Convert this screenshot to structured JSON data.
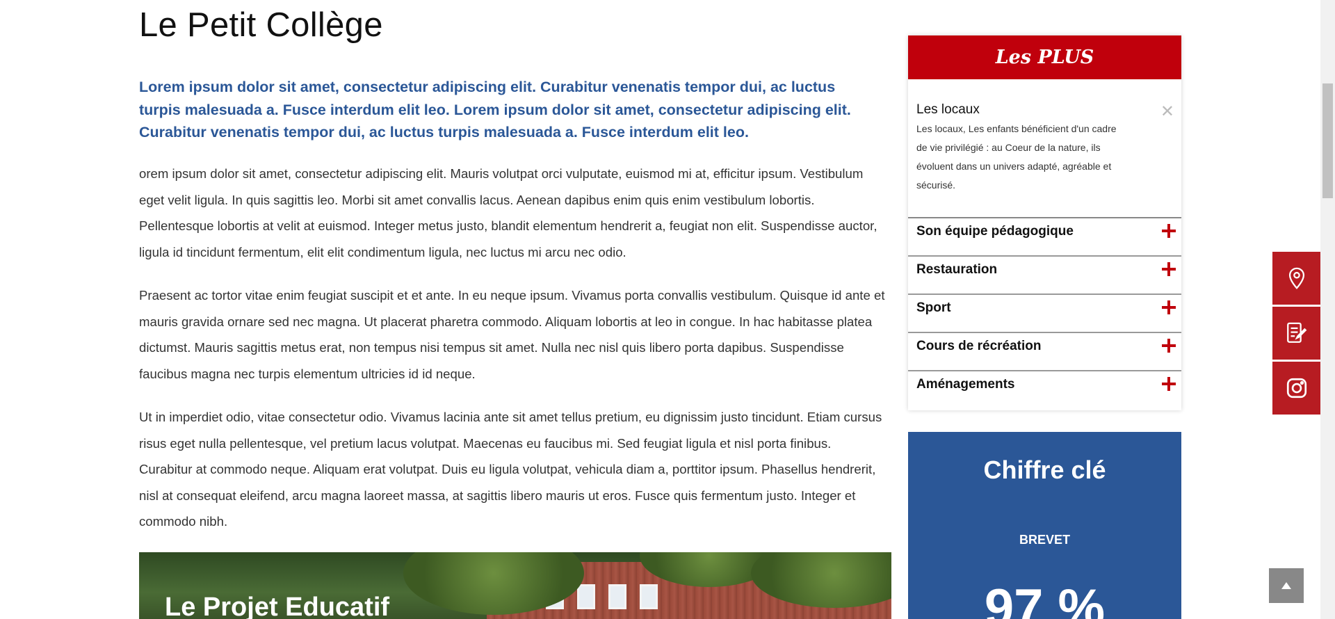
{
  "main": {
    "title": "Le Petit Collège",
    "lead": "Lorem ipsum dolor sit amet, consectetur adipiscing elit. Curabitur venenatis tempor dui, ac luctus turpis malesuada a. Fusce interdum elit leo. Lorem ipsum dolor sit amet, consectetur adipiscing elit. Curabitur venenatis tempor dui, ac luctus turpis malesuada a. Fusce interdum elit leo.",
    "paragraphs": [
      "orem ipsum dolor sit amet, consectetur adipiscing elit. Mauris volutpat orci vulputate, euismod mi at, efficitur ipsum. Vestibulum eget velit ligula. In quis sagittis leo. Morbi sit amet convallis lacus. Aenean dapibus enim quis enim vestibulum lobortis. Pellentesque lobortis at velit at euismod. Integer metus justo, blandit elementum hendrerit a, feugiat non elit. Suspendisse auctor, ligula id tincidunt fermentum, elit elit condimentum ligula, nec luctus mi arcu nec odio.",
      "Praesent ac tortor vitae enim feugiat suscipit et et ante. In eu neque ipsum. Vivamus porta convallis vestibulum. Quisque id ante et mauris gravida ornare sed nec magna. Ut placerat pharetra commodo. Aliquam lobortis at leo in congue. In hac habitasse platea dictumst. Mauris sagittis metus erat, non tempus nisi tempus sit amet. Nulla nec nisl quis libero porta dapibus. Suspendisse faucibus magna nec turpis elementum ultricies id id neque.",
      "Ut in imperdiet odio, vitae consectetur odio. Vivamus lacinia ante sit amet tellus pretium, eu dignissim justo tincidunt. Etiam cursus risus eget nulla pellentesque, vel pretium lacus volutpat. Maecenas eu faucibus mi. Sed feugiat ligula et nisl porta finibus. Curabitur at commodo neque. Aliquam erat volutpat. Duis eu ligula volutpat, vehicula diam a, porttitor ipsum. Phasellus hendrerit, nisl at consequat eleifend, arcu magna laoreet massa, at sagittis libero mauris ut eros. Fusce quis fermentum justo. Integer et commodo nibh."
    ],
    "hero_title": "Le Projet Educatif"
  },
  "sidebar": {
    "plus_title": "Les PLUS",
    "open_item": {
      "title": "Les locaux",
      "close_glyph": "✕",
      "body": "Les locaux, Les enfants bénéficient d'un cadre de vie privilégié : au Coeur de la nature, ils évoluent dans un univers adapté, agréable et sécurisé."
    },
    "items": [
      {
        "label": "Son équipe pédagogique"
      },
      {
        "label": "Restauration"
      },
      {
        "label": "Sport"
      },
      {
        "label": "Cours de récréation"
      },
      {
        "label": "Aménagements"
      }
    ],
    "key_figure": {
      "title": "Chiffre clé",
      "label": "BREVET",
      "value": "97 %"
    }
  },
  "floating_buttons": [
    {
      "icon": "map-pin-icon"
    },
    {
      "icon": "document-edit-icon"
    },
    {
      "icon": "instagram-icon"
    }
  ],
  "colors": {
    "accent_red": "#c0000c",
    "brand_blue": "#2b5797",
    "float_red": "#b71c22"
  }
}
